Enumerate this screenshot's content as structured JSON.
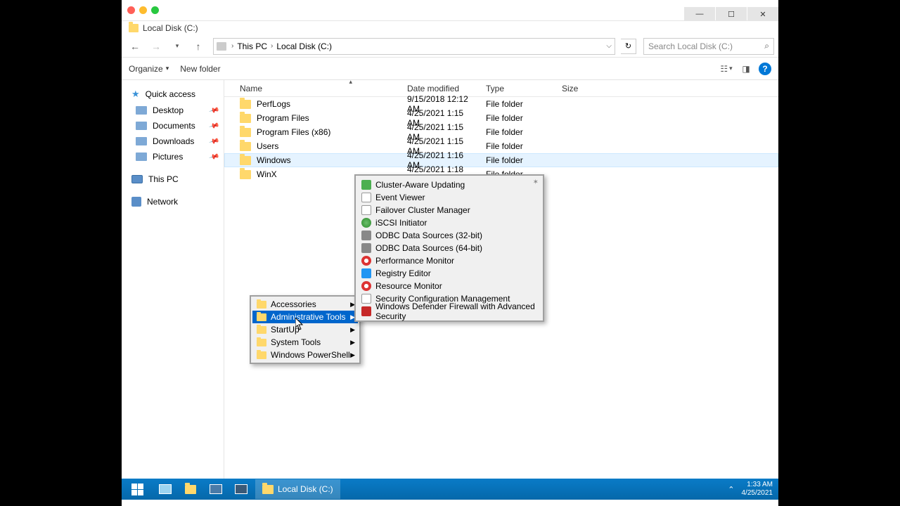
{
  "window": {
    "title": "Local Disk (C:)"
  },
  "nav": {
    "back": "←",
    "forward": "→",
    "up": "↑"
  },
  "breadcrumb": {
    "seg0": "",
    "seg1": "This PC",
    "seg2": "Local Disk (C:)"
  },
  "search": {
    "placeholder": "Search Local Disk (C:)"
  },
  "cmdbar": {
    "organize": "Organize",
    "newfolder": "New folder"
  },
  "columns": {
    "name": "Name",
    "date": "Date modified",
    "type": "Type",
    "size": "Size"
  },
  "sidebar": {
    "quick": "Quick access",
    "desktop": "Desktop",
    "documents": "Documents",
    "downloads": "Downloads",
    "pictures": "Pictures",
    "thispc": "This PC",
    "network": "Network"
  },
  "files": [
    {
      "name": "PerfLogs",
      "date": "9/15/2018 12:12 AM",
      "type": "File folder"
    },
    {
      "name": "Program Files",
      "date": "4/25/2021 1:15 AM",
      "type": "File folder"
    },
    {
      "name": "Program Files (x86)",
      "date": "4/25/2021 1:15 AM",
      "type": "File folder"
    },
    {
      "name": "Users",
      "date": "4/25/2021 1:15 AM",
      "type": "File folder"
    },
    {
      "name": "Windows",
      "date": "4/25/2021 1:16 AM",
      "type": "File folder"
    },
    {
      "name": "WinX",
      "date": "4/25/2021 1:18 AM",
      "type": "File folder"
    }
  ],
  "ctx_main": [
    {
      "label": "Accessories"
    },
    {
      "label": "Administrative Tools"
    },
    {
      "label": "StartUp"
    },
    {
      "label": "System Tools"
    },
    {
      "label": "Windows PowerShell"
    }
  ],
  "ctx_sub": [
    {
      "label": "Cluster-Aware Updating",
      "icon": "green"
    },
    {
      "label": "Event Viewer",
      "icon": "doc"
    },
    {
      "label": "Failover Cluster Manager",
      "icon": "doc"
    },
    {
      "label": "iSCSI Initiator",
      "icon": "globe"
    },
    {
      "label": "ODBC Data Sources (32-bit)",
      "icon": "db"
    },
    {
      "label": "ODBC Data Sources (64-bit)",
      "icon": "db"
    },
    {
      "label": "Performance Monitor",
      "icon": "red"
    },
    {
      "label": "Registry Editor",
      "icon": "blue"
    },
    {
      "label": "Resource Monitor",
      "icon": "red"
    },
    {
      "label": "Security Configuration Management",
      "icon": "doc"
    },
    {
      "label": "Windows Defender Firewall with Advanced Security",
      "icon": "shield"
    }
  ],
  "taskbar": {
    "app": "Local Disk (C:)"
  },
  "tray": {
    "time": "1:33 AM",
    "date": "4/25/2021"
  }
}
